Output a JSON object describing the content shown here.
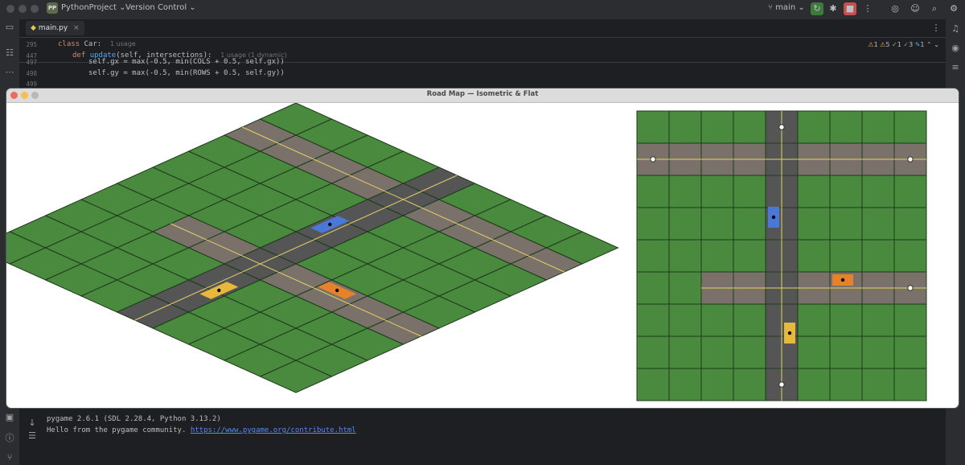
{
  "titlebar": {
    "project_badge": "PP",
    "project_name": "PythonProject",
    "vcs_label": "Version Control",
    "branch": "main"
  },
  "editor": {
    "tab_label": "main.py",
    "sticky": [
      {
        "line": "295",
        "code_kw": "class ",
        "code_name": "Car:",
        "hint": "1 usage"
      },
      {
        "line": "447",
        "code_kw": "def ",
        "code_name": "update",
        "code_rest": "(self, intersections):",
        "hint": "1 usage (1 dynamic)"
      }
    ],
    "lines": [
      {
        "line": "497",
        "text": "self.gx = max(-0.5, min(COLS + 0.5, self.gx))"
      },
      {
        "line": "498",
        "text": "self.gy = max(-0.5, min(ROWS + 0.5, self.gy))"
      },
      {
        "line": "499",
        "text": ""
      }
    ],
    "inspections": {
      "warnings": "1",
      "weak_warnings": "5",
      "typos": "1",
      "ok": "3",
      "edits": "1"
    }
  },
  "console": {
    "lines": [
      "pygame 2.6.1 (SDL 2.28.4, Python 3.13.2)",
      "Hello from the pygame community. "
    ],
    "link": "https://www.pygame.org/contribute.html"
  },
  "pygame_window": {
    "title": "Road Map — Isometric & Flat",
    "grid": {
      "cols": 9,
      "rows": 9
    },
    "colors": {
      "grass": "#4a8a3f",
      "road": "#7a716a",
      "road_dark": "#555555",
      "center_line": "#e3d265",
      "grid_line": "#1e3b1a",
      "car_blue": "#4a78d8",
      "car_orange": "#e8822a",
      "car_yellow": "#e8b83a"
    },
    "roads": [
      {
        "orientation": "horizontal",
        "row": 1,
        "from": 0,
        "to": 8
      },
      {
        "orientation": "horizontal",
        "row": 5,
        "from": 2,
        "to": 8
      },
      {
        "orientation": "vertical",
        "col": 4,
        "from": 0,
        "to": 8
      }
    ],
    "cars": [
      {
        "name": "blue",
        "gx": 4.25,
        "gy": 3.3,
        "dir": "vertical"
      },
      {
        "name": "orange",
        "gx": 6.4,
        "gy": 5.25,
        "dir": "horizontal"
      },
      {
        "name": "yellow",
        "gx": 4.75,
        "gy": 6.9,
        "dir": "vertical"
      }
    ],
    "markers": [
      {
        "gx": 4.5,
        "gy": 0.5
      },
      {
        "gx": 0.5,
        "gy": 1.5
      },
      {
        "gx": 8.5,
        "gy": 1.5
      },
      {
        "gx": 8.5,
        "gy": 5.5
      },
      {
        "gx": 4.5,
        "gy": 8.5
      }
    ]
  }
}
